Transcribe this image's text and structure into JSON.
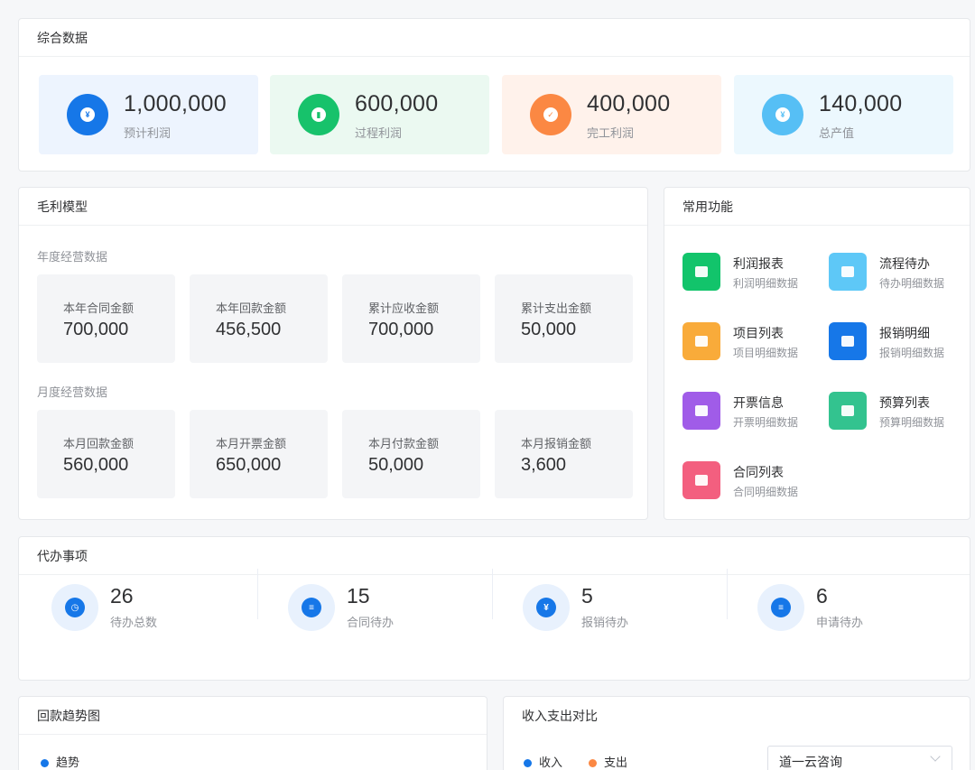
{
  "summary": {
    "title": "综合数据",
    "items": [
      {
        "value": "1,000,000",
        "label": "预计利润",
        "icon": "yen-icon",
        "color": "#1677e8",
        "bg": "#edf4fe",
        "glyph": "¥"
      },
      {
        "value": "600,000",
        "label": "过程利润",
        "icon": "bar-chart-icon",
        "color": "#17c26b",
        "bg": "#ebf9f1",
        "glyph": "▮"
      },
      {
        "value": "400,000",
        "label": "完工利润",
        "icon": "check-icon",
        "color": "#fb8843",
        "bg": "#fff2eb",
        "glyph": "✓"
      },
      {
        "value": "140,000",
        "label": "总产值",
        "icon": "yen-icon",
        "color": "#56bff5",
        "bg": "#ecf8fe",
        "glyph": "¥"
      }
    ]
  },
  "gross": {
    "title": "毛利模型",
    "annual_label": "年度经营数据",
    "monthly_label": "月度经营数据",
    "annual": [
      {
        "label": "本年合同金额",
        "value": "700,000"
      },
      {
        "label": "本年回款金额",
        "value": "456,500"
      },
      {
        "label": "累计应收金额",
        "value": "700,000"
      },
      {
        "label": "累计支出金额",
        "value": "50,000"
      }
    ],
    "monthly": [
      {
        "label": "本月回款金额",
        "value": "560,000"
      },
      {
        "label": "本月开票金额",
        "value": "650,000"
      },
      {
        "label": "本月付款金额",
        "value": "50,000"
      },
      {
        "label": "本月报销金额",
        "value": "3,600"
      }
    ]
  },
  "functions": {
    "title": "常用功能",
    "items": [
      {
        "title": "利润报表",
        "sub": "利润明细数据",
        "icon": "trend-chart-icon",
        "color": "#12c46b"
      },
      {
        "title": "流程待办",
        "sub": "待办明细数据",
        "icon": "compass-icon",
        "color": "#5ec8f7"
      },
      {
        "title": "项目列表",
        "sub": "项目明细数据",
        "icon": "document-icon",
        "color": "#f9ab3a"
      },
      {
        "title": "报销明细",
        "sub": "报销明细数据",
        "icon": "bar-chart-icon",
        "color": "#1677e8"
      },
      {
        "title": "开票信息",
        "sub": "开票明细数据",
        "icon": "columns-icon",
        "color": "#a05ce8"
      },
      {
        "title": "预算列表",
        "sub": "预算明细数据",
        "icon": "clipboard-icon",
        "color": "#33c38f"
      },
      {
        "title": "合同列表",
        "sub": "合同明细数据",
        "icon": "user-icon",
        "color": "#f35f7f"
      }
    ]
  },
  "todo": {
    "title": "代办事项",
    "items": [
      {
        "count": "26",
        "label": "待办总数",
        "icon": "clock-icon",
        "glyph": "◷"
      },
      {
        "count": "15",
        "label": "合同待办",
        "icon": "clipboard-icon",
        "glyph": "≡"
      },
      {
        "count": "5",
        "label": "报销待办",
        "icon": "yen-icon",
        "glyph": "¥"
      },
      {
        "count": "6",
        "label": "申请待办",
        "icon": "document-icon",
        "glyph": "≡"
      }
    ]
  },
  "trend": {
    "title": "回款趋势图",
    "legend": "趋势",
    "legend_color": "#1677e8"
  },
  "compare": {
    "title": "收入支出对比",
    "legend": [
      {
        "label": "收入",
        "color": "#1677e8"
      },
      {
        "label": "支出",
        "color": "#fb8843"
      }
    ],
    "select_value": "道一云咨询"
  }
}
